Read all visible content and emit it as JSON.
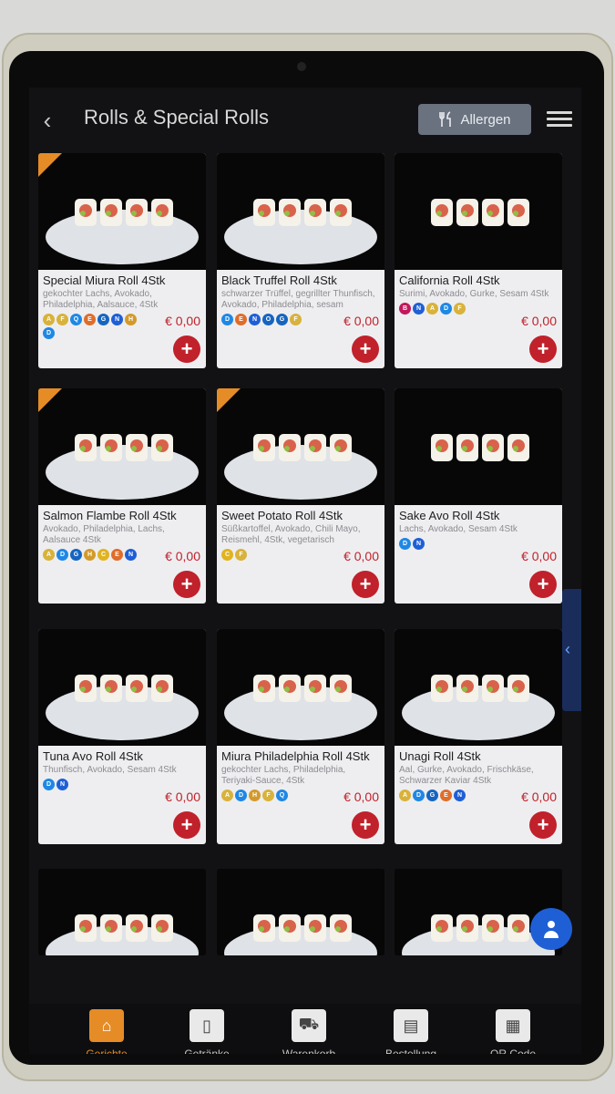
{
  "header": {
    "title": "Rolls & Special Rolls",
    "allergen_label": "Allergen"
  },
  "items": [
    {
      "name": "Special Miura Roll 4Stk",
      "desc": "gekochter Lachs, Avokado, Philadelphia, Aalsauce, 4Stk",
      "price": "€ 0,00",
      "badges": [
        "A",
        "F",
        "Q",
        "E",
        "G",
        "N",
        "H",
        "D"
      ],
      "tag": true
    },
    {
      "name": "Black Truffel Roll 4Stk",
      "desc": "schwarzer Trüffel, gegrillter Thunfisch, Avokado, Philadelphia, sesam",
      "price": "€ 0,00",
      "badges": [
        "D",
        "E",
        "N",
        "O",
        "G",
        "F"
      ],
      "tag": false
    },
    {
      "name": "California Roll 4Stk",
      "desc": "Surimi, Avokado, Gurke, Sesam 4Stk",
      "price": "€ 0,00",
      "badges": [
        "B",
        "N",
        "A",
        "D",
        "F"
      ],
      "tag": false
    },
    {
      "name": "Salmon Flambe Roll 4Stk",
      "desc": "Avokado, Philadelphia, Lachs, Aalsauce 4Stk",
      "price": "€ 0,00",
      "badges": [
        "A",
        "D",
        "G",
        "H",
        "C",
        "E",
        "N"
      ],
      "tag": true
    },
    {
      "name": "Sweet Potato Roll 4Stk",
      "desc": "Süßkartoffel, Avokado, Chili Mayo, Reismehl, 4Stk, vegetarisch",
      "price": "€ 0,00",
      "badges": [
        "C",
        "F"
      ],
      "tag": true
    },
    {
      "name": "Sake Avo Roll 4Stk",
      "desc": "Lachs, Avokado, Sesam 4Stk",
      "price": "€ 0,00",
      "badges": [
        "D",
        "N"
      ],
      "tag": false
    },
    {
      "name": "Tuna Avo Roll 4Stk",
      "desc": "Thunfisch, Avokado, Sesam 4Stk",
      "price": "€ 0,00",
      "badges": [
        "D",
        "N"
      ],
      "tag": false
    },
    {
      "name": "Miura Philadelphia Roll 4Stk",
      "desc": "gekochter Lachs, Philadelphia, Teriyaki-Sauce, 4Stk",
      "price": "€ 0,00",
      "badges": [
        "A",
        "D",
        "H",
        "F",
        "Q"
      ],
      "tag": false
    },
    {
      "name": "Unagi Roll 4Stk",
      "desc": "Aal, Gurke, Avokado, Frischkäse, Schwarzer Kaviar 4Stk",
      "price": "€ 0,00",
      "badges": [
        "A",
        "D",
        "G",
        "E",
        "N"
      ],
      "tag": false
    },
    {
      "name": "",
      "desc": "",
      "price": "",
      "badges": [],
      "tag": false
    },
    {
      "name": "",
      "desc": "",
      "price": "",
      "badges": [],
      "tag": false
    },
    {
      "name": "",
      "desc": "",
      "price": "",
      "badges": [],
      "tag": false
    }
  ],
  "badge_colors": {
    "A": "#d8b23a",
    "B": "#c2185b",
    "C": "#e0b320",
    "D": "#1e88e5",
    "E": "#e06d2a",
    "F": "#d8b23a",
    "G": "#1565c0",
    "H": "#d39a2b",
    "N": "#1e5fd6",
    "O": "#1565c0",
    "Q": "#1e88e5"
  },
  "tabbar": {
    "tabs": [
      {
        "label": "Gerichte",
        "icon": "cloche-icon",
        "active": true
      },
      {
        "label": "Getränke",
        "icon": "drink-icon",
        "active": false
      },
      {
        "label": "Warenkorb",
        "icon": "cart-icon",
        "active": false
      },
      {
        "label": "Bestellung",
        "icon": "clipboard-icon",
        "active": false
      },
      {
        "label": "QR Code",
        "icon": "qr-code-icon",
        "active": false
      }
    ]
  }
}
